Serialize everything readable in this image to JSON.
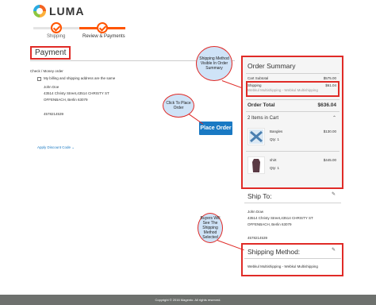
{
  "header": {
    "brand": "LUMA"
  },
  "progress": {
    "steps": [
      {
        "label": "Shipping"
      },
      {
        "label": "Review & Payments"
      }
    ]
  },
  "payment": {
    "title": "Payment",
    "method_label": "Check / Money order",
    "same_address_label": "My billing and shipping address are the same",
    "address": {
      "name": "John Doe",
      "street": "43514 Christy Street,43514 CHRISTY ST",
      "city": "OFFENBACH, Berlin 63079",
      "country": "",
      "phone": "4578214539"
    },
    "place_order_label": "Place Order",
    "discount_label": "Apply Discount Code"
  },
  "callouts": {
    "shipping_visible": "Shipping Method Visible In Order Summary",
    "click_place": "Click To Place Order",
    "buyers_see": "Buyers Will See The Shipping Method Selected"
  },
  "summary": {
    "title": "Order Summary",
    "subtotal_label": "Cart Subtotal",
    "subtotal_value": "$575.00",
    "shipping_label": "Shipping",
    "shipping_value": "$61.04",
    "shipping_detail": "Webkul Multishipping - Webkul Multishipping",
    "total_label": "Order Total",
    "total_value": "$636.04",
    "items_count_label": "2 Items in Cart",
    "items": [
      {
        "name": "Bangles",
        "price": "$130.00",
        "qty": "Qty: 1"
      },
      {
        "name": "shirt",
        "price": "$445.00",
        "qty": "Qty: 1"
      }
    ]
  },
  "ship_to": {
    "title": "Ship To:",
    "name": "John Dow",
    "street": "43514 Christy Street,43514 CHRISTY ST",
    "city": "OFFENBACH, Berlin 63079",
    "country": "",
    "phone": "4578214539"
  },
  "shipping_method": {
    "title": "Shipping Method:",
    "value": "Webkul Multishipping - Webkul Multishipping"
  },
  "footer": {
    "copyright": "Copyright © 2016 Magento. All rights reserved."
  },
  "colors": {
    "accent": "#ff5501",
    "button": "#1979c3",
    "highlight": "#e02b27",
    "callout_fill": "#cfe3f7"
  }
}
